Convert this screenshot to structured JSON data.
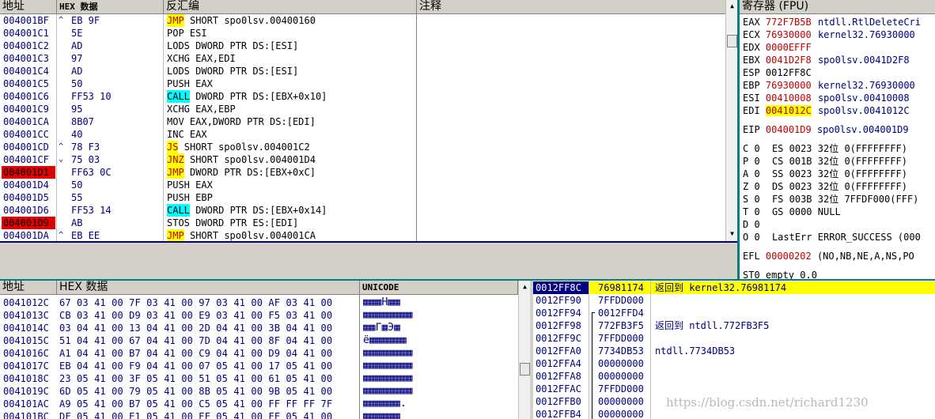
{
  "disasm": {
    "headers": {
      "addr": "地址",
      "hex": "HEX 数据",
      "asm": "反汇编",
      "comment": "注释"
    },
    "rows": [
      {
        "addr": "004001BF",
        "m": "^",
        "hex": "EB 9F",
        "op": "JMP",
        "rest": " SHORT spo0lsv.00400160",
        "kind": "jmp",
        "addr_hl": false
      },
      {
        "addr": "004001C1",
        "m": "",
        "hex": "5E",
        "op": "POP ESI",
        "rest": "",
        "kind": "",
        "addr_hl": false
      },
      {
        "addr": "004001C2",
        "m": "",
        "hex": "AD",
        "op": "LODS DWORD PTR DS:[ESI]",
        "rest": "",
        "kind": "",
        "addr_hl": false
      },
      {
        "addr": "004001C3",
        "m": "",
        "hex": "97",
        "op": "XCHG EAX,EDI",
        "rest": "",
        "kind": "",
        "addr_hl": false
      },
      {
        "addr": "004001C4",
        "m": "",
        "hex": "AD",
        "op": "LODS DWORD PTR DS:[ESI]",
        "rest": "",
        "kind": "",
        "addr_hl": false
      },
      {
        "addr": "004001C5",
        "m": "",
        "hex": "50",
        "op": "PUSH EAX",
        "rest": "",
        "kind": "",
        "addr_hl": false
      },
      {
        "addr": "004001C6",
        "m": "",
        "hex": "FF53 10",
        "op": "CALL",
        "rest": " DWORD PTR DS:[EBX+0x10]",
        "kind": "call",
        "addr_hl": false
      },
      {
        "addr": "004001C9",
        "m": "",
        "hex": "95",
        "op": "XCHG EAX,EBP",
        "rest": "",
        "kind": "",
        "addr_hl": false
      },
      {
        "addr": "004001CA",
        "m": "",
        "hex": "8B07",
        "op": "MOV EAX,DWORD PTR DS:[EDI]",
        "rest": "",
        "kind": "",
        "addr_hl": false
      },
      {
        "addr": "004001CC",
        "m": "",
        "hex": "40",
        "op": "INC EAX",
        "rest": "",
        "kind": "",
        "addr_hl": false
      },
      {
        "addr": "004001CD",
        "m": "^",
        "hex": "78 F3",
        "op": "JS",
        "rest": " SHORT spo0lsv.004001C2",
        "kind": "jmp",
        "addr_hl": false
      },
      {
        "addr": "004001CF",
        "m": "⌄",
        "hex": "75 03",
        "op": "JNZ",
        "rest": " SHORT spo0lsv.004001D4",
        "kind": "jmp",
        "addr_hl": false
      },
      {
        "addr": "004001D1",
        "m": "",
        "hex": "FF63 0C",
        "op": "JMP",
        "rest": " DWORD PTR DS:[EBX+0xC]",
        "kind": "jmp",
        "addr_hl": true
      },
      {
        "addr": "004001D4",
        "m": "",
        "hex": "50",
        "op": "PUSH EAX",
        "rest": "",
        "kind": "",
        "addr_hl": false
      },
      {
        "addr": "004001D5",
        "m": "",
        "hex": "55",
        "op": "PUSH EBP",
        "rest": "",
        "kind": "",
        "addr_hl": false
      },
      {
        "addr": "004001D6",
        "m": "",
        "hex": "FF53 14",
        "op": "CALL",
        "rest": " DWORD PTR DS:[EBX+0x14]",
        "kind": "call",
        "addr_hl": false
      },
      {
        "addr": "004001D9",
        "m": "",
        "hex": "AB",
        "op": "STOS DWORD PTR ES:[EDI]",
        "rest": "",
        "kind": "",
        "addr_hl": true
      },
      {
        "addr": "004001DA",
        "m": "^",
        "hex": "EB EE",
        "op": "JMP",
        "rest": " SHORT spo0lsv.004001CA",
        "kind": "jmp",
        "addr_hl": false
      }
    ]
  },
  "registers": {
    "header": "寄存器 (FPU)",
    "gp": [
      {
        "n": "EAX",
        "v": "772F7B5B",
        "c": "ntdll.RtlDeleteCri",
        "red": true,
        "hl": false
      },
      {
        "n": "ECX",
        "v": "76930000",
        "c": "kernel32.76930000",
        "red": true,
        "hl": false
      },
      {
        "n": "EDX",
        "v": "0000EFFF",
        "c": "",
        "red": true,
        "hl": false
      },
      {
        "n": "EBX",
        "v": "0041D2F8",
        "c": "spo0lsv.0041D2F8",
        "red": true,
        "hl": false
      },
      {
        "n": "ESP",
        "v": "0012FF8C",
        "c": "",
        "red": false,
        "hl": false
      },
      {
        "n": "EBP",
        "v": "76930000",
        "c": "kernel32.76930000",
        "red": true,
        "hl": false
      },
      {
        "n": "ESI",
        "v": "00410008",
        "c": "spo0lsv.00410008",
        "red": true,
        "hl": false
      },
      {
        "n": "EDI",
        "v": "0041012C",
        "c": "spo0lsv.0041012C",
        "red": true,
        "hl": true
      }
    ],
    "eip": {
      "n": "EIP",
      "v": "004001D9",
      "c": "spo0lsv.004001D9"
    },
    "flags": [
      {
        "f": "C",
        "v": "0",
        "seg": "ES",
        "sv": "0023",
        "bits": "32位",
        "rng": "0(FFFFFFFF)"
      },
      {
        "f": "P",
        "v": "0",
        "seg": "CS",
        "sv": "001B",
        "bits": "32位",
        "rng": "0(FFFFFFFF)"
      },
      {
        "f": "A",
        "v": "0",
        "seg": "SS",
        "sv": "0023",
        "bits": "32位",
        "rng": "0(FFFFFFFF)"
      },
      {
        "f": "Z",
        "v": "0",
        "seg": "DS",
        "sv": "0023",
        "bits": "32位",
        "rng": "0(FFFFFFFF)"
      },
      {
        "f": "S",
        "v": "0",
        "seg": "FS",
        "sv": "003B",
        "bits": "32位",
        "rng": "7FFDF000(FFF)"
      },
      {
        "f": "T",
        "v": "0",
        "seg": "GS",
        "sv": "0000",
        "bits": "NULL",
        "rng": ""
      },
      {
        "f": "D",
        "v": "0",
        "seg": "",
        "sv": "",
        "bits": "",
        "rng": ""
      }
    ],
    "o_line": {
      "f": "O",
      "v": "0",
      "label": "LastErr",
      "val": "ERROR_SUCCESS (000"
    },
    "efl": {
      "n": "EFL",
      "v": "00000202",
      "d": "(NO,NB,NE,A,NS,PO"
    },
    "st0": "ST0 empty 0.0"
  },
  "dump": {
    "headers": {
      "addr": "地址",
      "hex": "HEX 数据",
      "uni": "UNICODE"
    },
    "rows": [
      {
        "a": "0041012C",
        "h": "67 03 41 00 7F 03 41 00 97 03 41 00 AF 03 41 00",
        "u": "▦▦▦H▦▦"
      },
      {
        "a": "0041013C",
        "h": "CB 03 41 00 D9 03 41 00 E9 03 41 00 F5 03 41 00",
        "u": "▦▦▦▦▦▦▦▦"
      },
      {
        "a": "0041014C",
        "h": "03 04 41 00 13 04 41 00 2D 04 41 00 3B 04 41 00",
        "u": "▦▦Γ▦Э▦"
      },
      {
        "a": "0041015C",
        "h": "51 04 41 00 67 04 41 00 7D 04 41 00 8F 04 41 00",
        "u": "ё▦▦▦▦▦▦"
      },
      {
        "a": "0041016C",
        "h": "A1 04 41 00 B7 04 41 00 C9 04 41 00 D9 04 41 00",
        "u": "▦▦▦▦▦▦▦▦"
      },
      {
        "a": "0041017C",
        "h": "EB 04 41 00 F9 04 41 00 07 05 41 00 17 05 41 00",
        "u": "▦▦▦▦▦▦▦▦"
      },
      {
        "a": "0041018C",
        "h": "23 05 41 00 3F 05 41 00 51 05 41 00 61 05 41 00",
        "u": "▦▦▦▦▦▦▦▦"
      },
      {
        "a": "0041019C",
        "h": "6D 05 41 00 79 05 41 00 8B 05 41 00 9B 05 41 00",
        "u": "▦▦▦▦▦▦▦▦"
      },
      {
        "a": "004101AC",
        "h": "A9 05 41 00 B7 05 41 00 C5 05 41 00 FF FF FF 7F",
        "u": "▦▦▦▦▦▦."
      },
      {
        "a": "004101BC",
        "h": "DF 05 41 00 E1 05 41 00 EF 05 41 00 FF 05 41 00",
        "u": "▦▦▦▦▦▦"
      }
    ]
  },
  "stack": {
    "rows": [
      {
        "a": "0012FF8C",
        "v": "76981174",
        "c": "返回到 kernel32.76981174",
        "sel": true,
        "br": ""
      },
      {
        "a": "0012FF90",
        "v": "7FFDD000",
        "c": "",
        "sel": false,
        "br": ""
      },
      {
        "a": "0012FF94",
        "v": "0012FFD4",
        "c": "",
        "sel": false,
        "br": "top"
      },
      {
        "a": "0012FF98",
        "v": "772FB3F5",
        "c": "返回到 ntdll.772FB3F5",
        "sel": false,
        "br": "mid"
      },
      {
        "a": "0012FF9C",
        "v": "7FFDD000",
        "c": "",
        "sel": false,
        "br": "mid"
      },
      {
        "a": "0012FFA0",
        "v": "7734DB53",
        "c": "ntdll.7734DB53",
        "sel": false,
        "br": "mid"
      },
      {
        "a": "0012FFA4",
        "v": "00000000",
        "c": "",
        "sel": false,
        "br": "mid"
      },
      {
        "a": "0012FFA8",
        "v": "00000000",
        "c": "",
        "sel": false,
        "br": "mid"
      },
      {
        "a": "0012FFAC",
        "v": "7FFDD000",
        "c": "",
        "sel": false,
        "br": "mid"
      },
      {
        "a": "0012FFB0",
        "v": "00000000",
        "c": "",
        "sel": false,
        "br": "mid"
      },
      {
        "a": "0012FFB4",
        "v": "00000000",
        "c": "",
        "sel": false,
        "br": "mid"
      }
    ]
  },
  "watermark": "https://blog.csdn.net/richard1230"
}
